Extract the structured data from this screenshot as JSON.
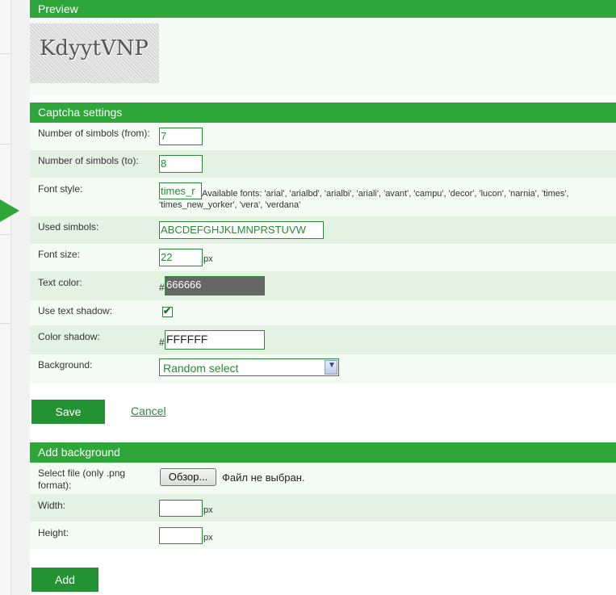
{
  "preview": {
    "header": "Preview",
    "captcha_text": "KdyytVNP"
  },
  "captcha_settings": {
    "header": "Captcha settings",
    "symbols_from": {
      "label": "Number of simbols (from):",
      "value": "7"
    },
    "symbols_to": {
      "label": "Number of simbols (to):",
      "value": "8"
    },
    "font_style": {
      "label": "Font style:",
      "value": "times_r",
      "note": "Available fonts: 'arial', 'arialbd', 'arialbi', 'ariali', 'avant', 'campu', 'decor', 'lucon', 'narnia', 'times', 'times_new_yorker', 'vera', 'verdana'"
    },
    "used_symbols": {
      "label": "Used simbols:",
      "value": "ABCDEFGHJKLMNPRSTUVW"
    },
    "font_size": {
      "label": "Font size:",
      "value": "22",
      "unit": "px"
    },
    "text_color": {
      "label": "Text color:",
      "hash": "#",
      "value": "666666",
      "swatch": "#666666"
    },
    "text_shadow": {
      "label": "Use text shadow:",
      "checked": true,
      "mark": "✔"
    },
    "color_shadow": {
      "label": "Color shadow:",
      "hash": "#",
      "value": "FFFFFF"
    },
    "background": {
      "label": "Background:",
      "value": "Random select"
    },
    "save_label": "Save",
    "cancel_label": "Cancel"
  },
  "add_background": {
    "header": "Add background",
    "select_file": {
      "label": "Select file (only .png format):",
      "button": "Обзор...",
      "status": "Файл не выбран."
    },
    "width": {
      "label": "Width:",
      "value": "",
      "unit": "px"
    },
    "height": {
      "label": "Height:",
      "value": "",
      "unit": "px"
    },
    "add_label": "Add"
  },
  "colors": {
    "accent": "#2ea63a",
    "button": "#229233",
    "row_alt": "#e4f2e4",
    "row": "#f4fbf4"
  }
}
